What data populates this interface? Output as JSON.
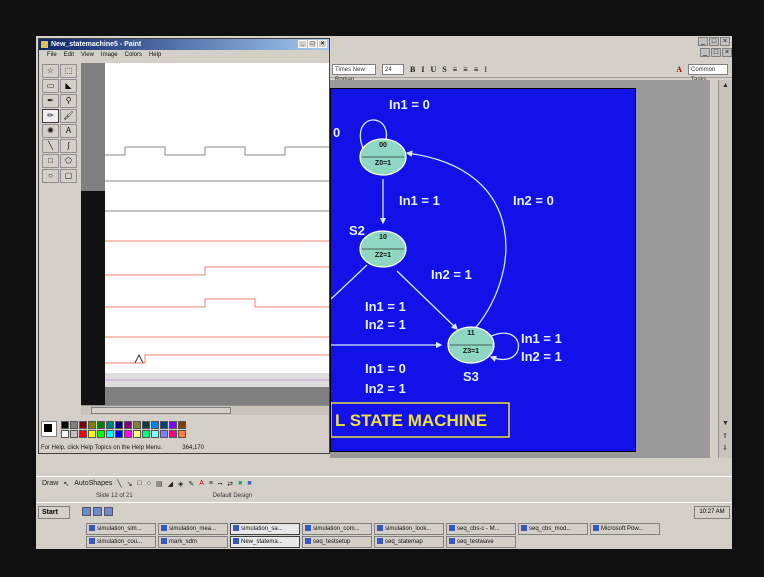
{
  "paint": {
    "title": "New_statemachine5 - Paint",
    "menu": [
      "File",
      "Edit",
      "View",
      "Image",
      "Colors",
      "Help"
    ],
    "tools": [
      "free-select",
      "select",
      "eraser",
      "fill",
      "picker",
      "magnifier",
      "pencil",
      "brush",
      "airbrush",
      "text",
      "line",
      "curve",
      "rectangle",
      "polygon",
      "ellipse",
      "rounded-rect"
    ],
    "status_help": "For Help, click Help Topics on the Help Menu.",
    "status_coords": "364,170",
    "palette": [
      "#000000",
      "#808080",
      "#800000",
      "#808000",
      "#008000",
      "#008080",
      "#000080",
      "#800080",
      "#808040",
      "#004040",
      "#0080ff",
      "#004080",
      "#8000ff",
      "#804000",
      "#ffffff",
      "#c0c0c0",
      "#ff0000",
      "#ffff00",
      "#00ff00",
      "#00ffff",
      "#0000ff",
      "#ff00ff",
      "#ffff80",
      "#00ff80",
      "#80ffff",
      "#8080ff",
      "#ff0080",
      "#ff8040"
    ]
  },
  "ppt": {
    "font_field": "Times New Roman",
    "size_field": "24",
    "tasks_field": "Common Tasks",
    "format_buttons": [
      "B",
      "I",
      "U",
      "S"
    ],
    "slide": {
      "title": "L STATE MACHINE",
      "labels": {
        "in1_0_top": "In1 = 0",
        "in1_1": "In1 = 1",
        "in2_0": "In2 = 0",
        "in2_1_mid": "In2 = 1",
        "s2": "S2",
        "in1_1_b": "In1 = 1",
        "in2_1_b": "In2 = 1",
        "in1_1_r": "In1 = 1",
        "in2_1_r": "In2 = 1",
        "in1_0_bot": "In1 = 0",
        "in2_1_bot": "In2 = 1",
        "s3": "S3",
        "left_zero": "0"
      },
      "states": [
        {
          "code": "00",
          "out": "Z0=1"
        },
        {
          "code": "10",
          "out": "Z2=1"
        },
        {
          "code": "11",
          "out": "Z3=1"
        }
      ]
    },
    "draw_label": "Draw",
    "autoshapes_label": "AutoShapes",
    "status_slide": "Slide 12 of 21",
    "status_design": "Default Design"
  },
  "taskbar": {
    "start": "Start",
    "clock": "10:27 AM",
    "row1": [
      "simulation_sim...",
      "simulation_mea...",
      "simulation_sa...",
      "simulation_com...",
      "simulation_look...",
      "seq_cbs-c - M...",
      "seq_cbs_mod...",
      "Microsoft Pow..."
    ],
    "row2": [
      "simulation_cou...",
      "mark_sdm",
      "New_statema...",
      "seq_testsetup",
      "seq_statemap",
      "seq_testwave"
    ]
  },
  "colors": {
    "slide_bg": "#1212e8",
    "state_fill": "#8fd7c0",
    "slide_text": "#e8f0ff",
    "title_text": "#f0e040"
  }
}
